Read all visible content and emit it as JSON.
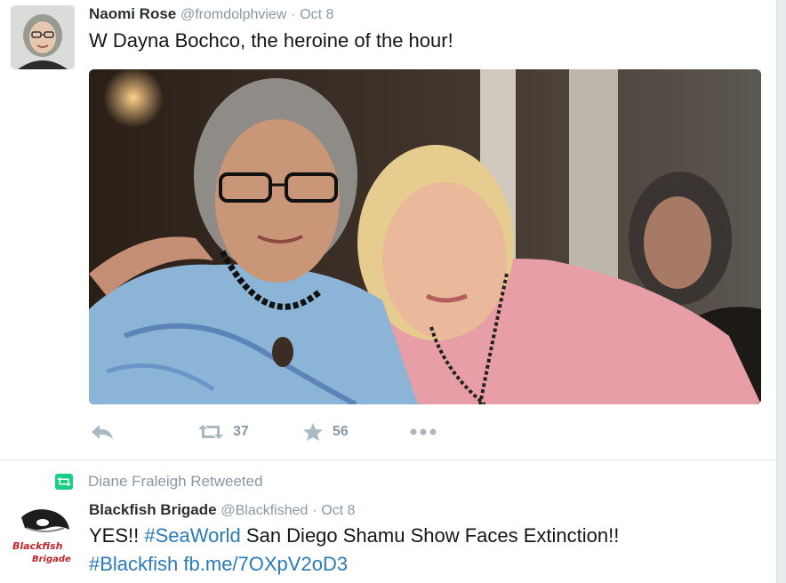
{
  "tweet1": {
    "author_name": "Naomi Rose",
    "handle": "@fromdolphview",
    "separator": "·",
    "time": "Oct 8",
    "text": "W Dayna Bochco, the heroine of the hour!",
    "actions": {
      "retweet_count": "37",
      "favorite_count": "56"
    },
    "icons": [
      "reply-icon",
      "retweet-icon",
      "favorite-star-icon",
      "more-dots-icon"
    ]
  },
  "tweet2": {
    "retweeted_by": "Diane Fraleigh Retweeted",
    "author_name": "Blackfish Brigade",
    "handle": "@Blackfished",
    "separator": "·",
    "time": "Oct 8",
    "text_prefix": "YES!! ",
    "hashtag1": "#SeaWorld",
    "text_suffix": " San Diego Shamu Show Faces Extinction!!",
    "hashtag2": "#Blackfish",
    "link": "fb.me/7OXpV2oD3",
    "avatar_logo_text_1": "Blackfish",
    "avatar_logo_text_2": "Brigade"
  },
  "colors": {
    "link_blue": "#2b7bb9",
    "muted_gray": "#8899a6",
    "retweet_green": "#19cf86",
    "action_gray": "#aab8c2"
  }
}
